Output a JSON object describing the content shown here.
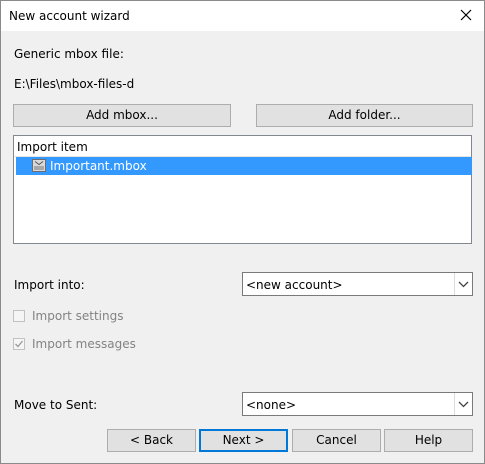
{
  "window": {
    "title": "New account wizard"
  },
  "source": {
    "label": "Generic mbox file:",
    "path": "E:\\Files\\mbox-files-d"
  },
  "buttons": {
    "add_mbox": "Add mbox...",
    "add_folder": "Add folder..."
  },
  "import_list": {
    "header": "Import item",
    "items": [
      {
        "name": "Important.mbox",
        "selected": true
      }
    ]
  },
  "import_into": {
    "label": "Import into:",
    "value": "<new account>"
  },
  "options": {
    "import_settings": {
      "label": "Import settings",
      "checked": false,
      "enabled": false
    },
    "import_messages": {
      "label": "Import messages",
      "checked": true,
      "enabled": false
    }
  },
  "move_to_sent": {
    "label": "Move to Sent:",
    "value": "<none>"
  },
  "footer": {
    "back": "< Back",
    "next": "Next >",
    "cancel": "Cancel",
    "help": "Help"
  },
  "colors": {
    "selection": "#3399ff",
    "default_border": "#0078d7"
  },
  "icons": {
    "close": "close-icon",
    "mbox_item": "mbox-file-icon",
    "dropdown": "chevron-down-icon",
    "check": "check-icon"
  }
}
